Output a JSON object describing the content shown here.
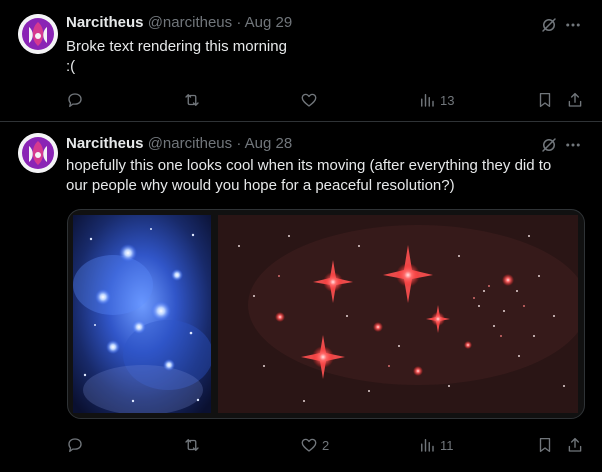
{
  "tweets": [
    {
      "author": "Narcitheus",
      "handle": "@narcitheus",
      "separator": "·",
      "date": "Aug 29",
      "lines": [
        "Broke text rendering this morning",
        ":("
      ],
      "stats": {
        "replies": "",
        "retweets": "",
        "likes": "",
        "views": "13"
      }
    },
    {
      "author": "Narcitheus",
      "handle": "@narcitheus",
      "separator": "·",
      "date": "Aug 28",
      "lines": [
        "hopefully this one looks cool when its moving (after everything they did to",
        "our people why would you hope for a peaceful resolution?)"
      ],
      "stats": {
        "replies": "",
        "retweets": "",
        "likes": "2",
        "views": "11"
      }
    }
  ],
  "colors": {
    "background": "#000000",
    "text_primary": "#e7e9ea",
    "text_secondary": "#71767b",
    "divider": "#2f3336",
    "avatar_accent": "#9b2fc2"
  },
  "icons": [
    "grok-icon",
    "more-icon",
    "reply-icon",
    "retweet-icon",
    "like-icon",
    "views-icon",
    "bookmark-icon",
    "share-icon"
  ]
}
